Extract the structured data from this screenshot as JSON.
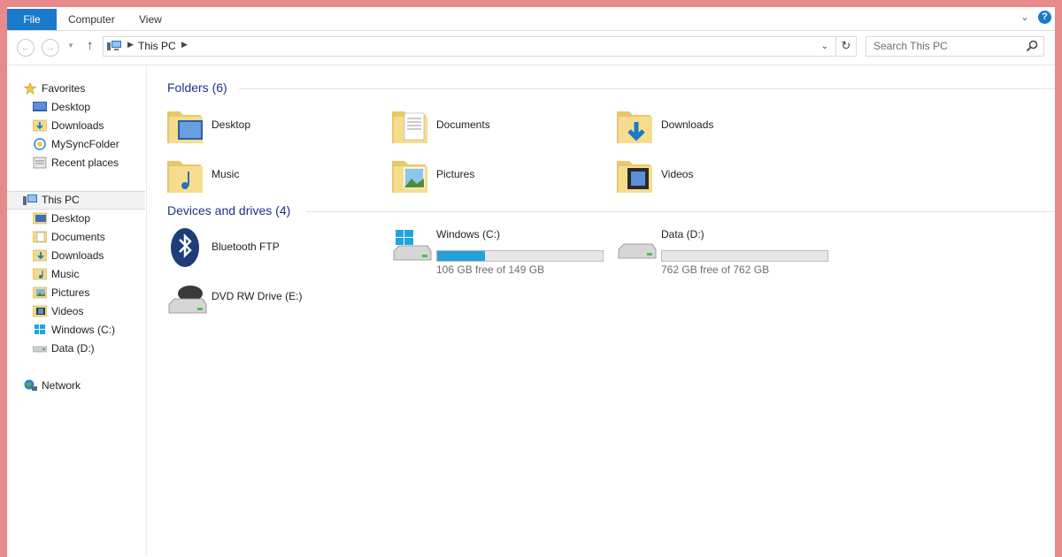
{
  "ribbon": {
    "tabs": [
      "File",
      "Computer",
      "View"
    ],
    "help": "?"
  },
  "nav": {
    "back_icon": "arrow-left-icon",
    "forward_icon": "arrow-right-icon",
    "up_icon": "arrow-up-icon",
    "address": "This PC",
    "search_placeholder": "Search This PC"
  },
  "sidebar": {
    "favorites": {
      "label": "Favorites",
      "items": [
        "Desktop",
        "Downloads",
        "MySyncFolder",
        "Recent places"
      ]
    },
    "this_pc": {
      "label": "This PC",
      "items": [
        "Desktop",
        "Documents",
        "Downloads",
        "Music",
        "Pictures",
        "Videos",
        "Windows (C:)",
        "Data (D:)"
      ]
    },
    "network": {
      "label": "Network"
    }
  },
  "content": {
    "folders_header": "Folders (6)",
    "folders": [
      "Desktop",
      "Documents",
      "Downloads",
      "Music",
      "Pictures",
      "Videos"
    ],
    "drives_header": "Devices and drives (4)",
    "devices": [
      {
        "name": "Bluetooth FTP"
      },
      {
        "name": "Windows (C:)",
        "free": "106 GB free of 149 GB",
        "used_fraction": 0.29
      },
      {
        "name": "Data (D:)",
        "free": "762 GB free of 762 GB",
        "used_fraction": 0.0
      },
      {
        "name": "DVD RW Drive (E:)"
      }
    ]
  },
  "colors": {
    "accent": "#1979ca",
    "bar_fill": "#26a0da",
    "group_header": "#1e3287",
    "desktop_bg": "#e8898c"
  }
}
